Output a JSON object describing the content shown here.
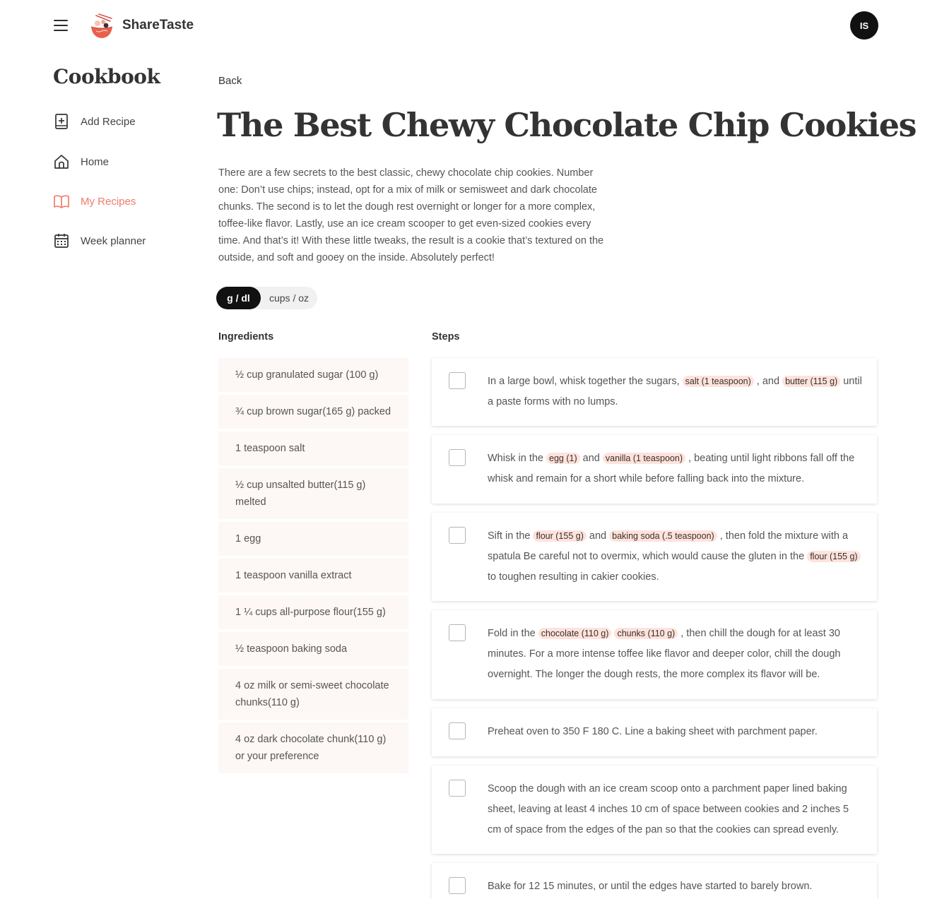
{
  "header": {
    "brand": "ShareTaste",
    "avatar_initials": "IS",
    "menu_icon": "hamburger-menu-icon",
    "logo_icon": "ramen-bowl-logo"
  },
  "sidebar": {
    "title": "Cookbook",
    "items": [
      {
        "label": "Add Recipe",
        "icon": "add-recipe-icon",
        "active": false
      },
      {
        "label": "Home",
        "icon": "home-icon",
        "active": false
      },
      {
        "label": "My Recipes",
        "icon": "open-book-icon",
        "active": true
      },
      {
        "label": "Week planner",
        "icon": "calendar-icon",
        "active": false
      }
    ]
  },
  "colors": {
    "accent": "#ef7c6a",
    "tag_bg": "#fde3db",
    "ingredient_bg": "#fdf7f5",
    "toggle_active": "#111111"
  },
  "main": {
    "back_label": "Back",
    "title": "The Best Chewy Chocolate Chip Cookies",
    "description": "There are a few secrets to the best classic, chewy chocolate chip cookies. Number one: Don’t use chips; instead, opt for a mix of milk or semisweet and dark chocolate chunks. The second is to let the dough rest overnight or longer for a more complex, toffee-like flavor. Lastly, use an ice cream scooper to get even-sized cookies every time. And that’s it! With these little tweaks, the result is a cookie that’s textured on the outside, and soft and gooey on the inside. Absolutely perfect!",
    "unit_toggle": {
      "active": "g / dl",
      "inactive": "cups / oz"
    },
    "ingredients_heading": "Ingredients",
    "steps_heading": "Steps",
    "ingredients": [
      "½ cup granulated sugar (100 g)",
      "¾ cup brown sugar(165 g) packed",
      "1 teaspoon salt",
      "½ cup unsalted butter(115 g) melted",
      "1 egg",
      "1 teaspoon vanilla extract",
      "1 ¼ cups all-purpose flour(155 g)",
      "½ teaspoon baking soda",
      "4 oz milk or semi-sweet chocolate chunks(110 g)",
      "4 oz dark chocolate chunk(110 g) or your preference"
    ],
    "steps": [
      {
        "t1": "In a large bowl, whisk together the sugars,",
        "tag1": "salt (1 teaspoon)",
        "t2": ", and",
        "tag2": "butter (115 g)",
        "t3": "until a paste forms with no lumps.",
        "tag3": "",
        "t4": "",
        "checked": false
      },
      {
        "t1": "Whisk in the",
        "tag1": "egg (1)",
        "t2": "and",
        "tag2": "vanilla (1 teaspoon)",
        "t3": ", beating until light ribbons fall off the whisk and remain for a short while before falling back into the mixture.",
        "tag3": "",
        "t4": "",
        "checked": false
      },
      {
        "t1": "Sift in the",
        "tag1": "flour (155 g)",
        "t2": "and",
        "tag2": "baking soda (.5 teaspoon)",
        "t3": ", then fold the mixture with a spatula Be careful not to overmix, which would cause the gluten in the",
        "tag3": "flour (155 g)",
        "t4": "to toughen resulting in cakier cookies.",
        "checked": false
      },
      {
        "t1": "Fold in the",
        "tag1": "chocolate (110 g)",
        "t2": "",
        "tag2": "chunks (110 g)",
        "t3": ", then chill the dough for at least 30 minutes. For a more intense toffee like flavor and deeper color, chill the dough overnight. The longer the dough rests, the more complex its flavor will be.",
        "tag3": "",
        "t4": "",
        "checked": false
      },
      {
        "t1": "Preheat oven to 350 F 180 C. Line a baking sheet with parchment paper.",
        "tag1": "",
        "t2": "",
        "tag2": "",
        "t3": "",
        "tag3": "",
        "t4": "",
        "checked": false
      },
      {
        "t1": "Scoop the dough with an ice cream scoop onto a parchment paper lined baking sheet, leaving at least 4 inches 10 cm of space between cookies and 2 inches 5 cm of space from the edges of the pan so that the cookies can spread evenly.",
        "tag1": "",
        "t2": "",
        "tag2": "",
        "t3": "",
        "tag3": "",
        "t4": "",
        "checked": false
      },
      {
        "t1": "Bake for 12 15 minutes, or until the edges have started to barely brown.",
        "tag1": "",
        "t2": "",
        "tag2": "",
        "t3": "",
        "tag3": "",
        "t4": "",
        "checked": false
      }
    ]
  }
}
